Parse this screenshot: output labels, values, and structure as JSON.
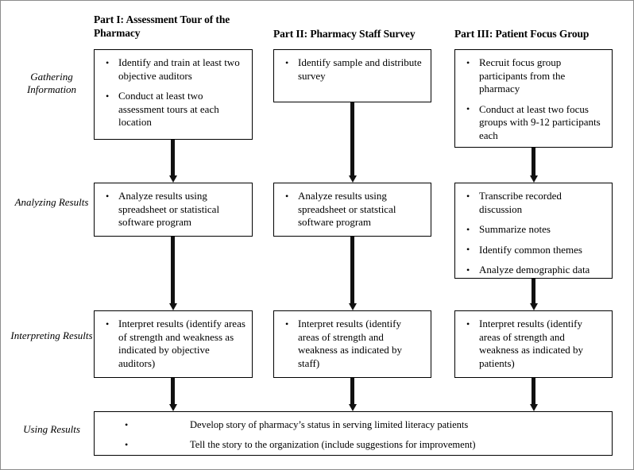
{
  "columns": [
    {
      "header": "Part I: Assessment Tour of the Pharmacy"
    },
    {
      "header": "Part II: Pharmacy Staff Survey"
    },
    {
      "header": "Part III: Patient Focus Group"
    }
  ],
  "row_labels": [
    "Gathering Information",
    "Analyzing Results",
    "Interpreting Results",
    "Using Results"
  ],
  "boxes": {
    "gathering": {
      "col1": [
        "Identify and train at least two objective auditors",
        "Conduct at least two assessment tours at each location"
      ],
      "col2": [
        "Identify sample and distribute survey"
      ],
      "col3": [
        "Recruit focus group participants from the pharmacy",
        "Conduct at least two focus groups with 9-12 participants each"
      ]
    },
    "analyzing": {
      "col1": [
        "Analyze results using spreadsheet or statistical software program"
      ],
      "col2": [
        "Analyze results using spreadsheet or statstical software program"
      ],
      "col3": [
        "Transcribe recorded discussion",
        "Summarize notes",
        "Identify common themes",
        "Analyze demographic data"
      ]
    },
    "interpreting": {
      "col1": [
        "Interpret results (identify areas of strength and weakness as indicated by objective auditors)"
      ],
      "col2": [
        "Interpret results (identify areas of strength and weakness as indicated by staff)"
      ],
      "col3": [
        "Interpret results (identify areas of strength and weakness as indicated by patients)"
      ]
    },
    "using": [
      "Develop story of pharmacy’s status in serving limited literacy patients",
      "Tell the story to the organization (include suggestions for improvement)"
    ]
  },
  "colors": {
    "ink": "#000000",
    "arrow": "#111111",
    "page_border": "#8c8c8c",
    "background": "#ffffff"
  }
}
